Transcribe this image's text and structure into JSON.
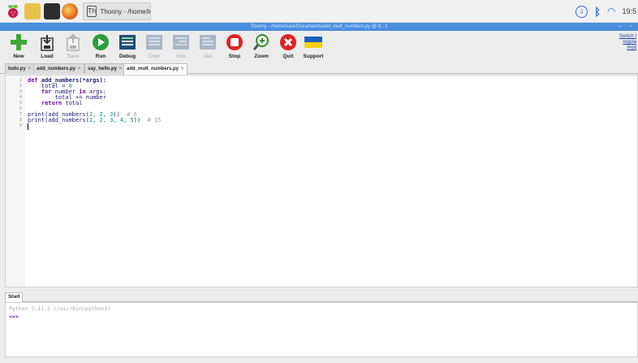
{
  "taskbar": {
    "window_label": "Thonny - /home/luc.",
    "time": "19:5",
    "icons": [
      "raspberry-icon",
      "files-icon",
      "terminal-icon",
      "browser-icon",
      "thonny-icon",
      "update-icon",
      "bluetooth-icon",
      "wifi-icon"
    ]
  },
  "titlebar": {
    "title": "Thonny - /home/luce/Documents/add_mult_numbers.py @ 9 : 1",
    "controls": "– ▫"
  },
  "toolbar": {
    "buttons": [
      {
        "label": "New",
        "enabled": true
      },
      {
        "label": "Load",
        "enabled": true
      },
      {
        "label": "Save",
        "enabled": false
      },
      {
        "label": "Run",
        "enabled": true
      },
      {
        "label": "Debug",
        "enabled": true
      },
      {
        "label": "Over",
        "enabled": false
      },
      {
        "label": "Into",
        "enabled": false
      },
      {
        "label": "Out",
        "enabled": false
      },
      {
        "label": "Stop",
        "enabled": true
      },
      {
        "label": "Zoom",
        "enabled": true
      },
      {
        "label": "Quit",
        "enabled": true
      },
      {
        "label": "Support",
        "enabled": true
      }
    ],
    "switch_link": [
      "Switch t",
      "regula",
      "mod"
    ]
  },
  "tabs": [
    {
      "label": "todo.py"
    },
    {
      "label": "add_numbers.py"
    },
    {
      "label": "say_hello.py"
    },
    {
      "label": "add_mult_numbers.py",
      "active": true
    }
  ],
  "tab_close": "✕",
  "editor": {
    "line_numbers": [
      "1",
      "2",
      "3",
      "4",
      "5",
      "6",
      "7",
      "8",
      "9"
    ],
    "lines": [
      {
        "kw": "def",
        "name": "add_numbers",
        "rest": "(*args):"
      },
      {
        "text": "    total = ",
        "num": "0"
      },
      {
        "kw": "    for",
        "text": " number ",
        "kw2": "in",
        "rest": " args:"
      },
      {
        "text": "        total += number"
      },
      {
        "kw": "    return",
        "rest": " total"
      },
      {
        "text": ""
      },
      {
        "text": "print(add_numbers(",
        "args": "1, 2, 3",
        "close": "))",
        "comment": "  # 6"
      },
      {
        "text": "print(add_numbers(",
        "args": "1, 2, 3, 4, 5",
        "close": "))",
        "comment": "  # 15"
      },
      {
        "text": ""
      }
    ]
  },
  "shell": {
    "tab_label": "Shell",
    "version": "Python 3.11.2 (/usr/bin/python3)",
    "prompt": ">>>"
  },
  "colors": {
    "titlebar": "#4a8ede",
    "keyword": "#6b0d9e",
    "number": "#0a8a7a",
    "comment": "#a0a0a0"
  }
}
